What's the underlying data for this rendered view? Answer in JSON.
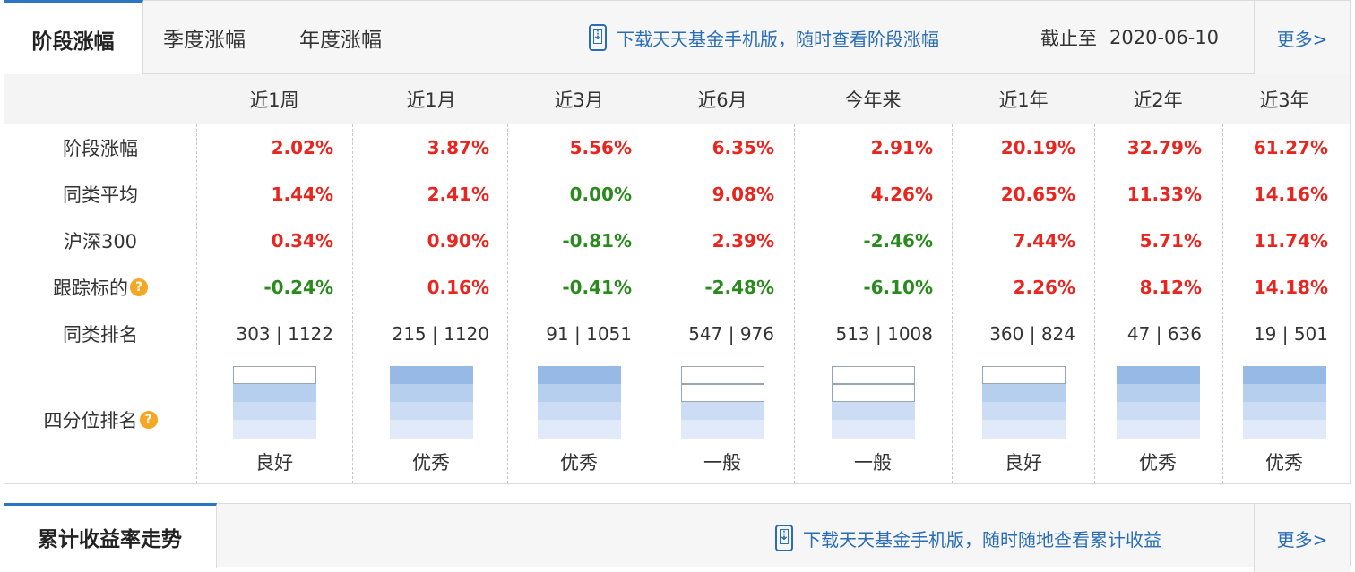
{
  "tabs": {
    "active": "阶段涨幅",
    "items": [
      "季度涨幅",
      "年度涨幅"
    ]
  },
  "promo1": "下载天天基金手机版，随时查看阶段涨幅",
  "date": {
    "label": "截止至",
    "value": "2020-06-10"
  },
  "more": "更多>",
  "columns": [
    "近1周",
    "近1月",
    "近3月",
    "近6月",
    "今年来",
    "近1年",
    "近2年",
    "近3年"
  ],
  "rows": [
    {
      "label": "阶段涨幅",
      "values": [
        "2.02%",
        "3.87%",
        "5.56%",
        "6.35%",
        "2.91%",
        "20.19%",
        "32.79%",
        "61.27%"
      ]
    },
    {
      "label": "同类平均",
      "values": [
        "1.44%",
        "2.41%",
        "0.00%",
        "9.08%",
        "4.26%",
        "20.65%",
        "11.33%",
        "14.16%"
      ]
    },
    {
      "label": "沪深300",
      "values": [
        "0.34%",
        "0.90%",
        "-0.81%",
        "2.39%",
        "-2.46%",
        "7.44%",
        "5.71%",
        "11.74%"
      ]
    },
    {
      "label": "跟踪标的",
      "values": [
        "-0.24%",
        "0.16%",
        "-0.41%",
        "-2.48%",
        "-6.10%",
        "2.26%",
        "8.12%",
        "14.18%"
      ]
    },
    {
      "label": "同类排名",
      "values": [
        "303 | 1122",
        "215 | 1120",
        "91 | 1051",
        "547 | 976",
        "513 | 1008",
        "360 | 824",
        "47 | 636",
        "19 | 501"
      ]
    }
  ],
  "quartile": {
    "label": "四分位排名",
    "ratings": [
      "良好",
      "优秀",
      "优秀",
      "一般",
      "一般",
      "良好",
      "优秀",
      "优秀"
    ],
    "levels": [
      3,
      4,
      4,
      2,
      2,
      3,
      4,
      4
    ]
  },
  "section2": {
    "title": "累计收益率走势",
    "promo": "下载天天基金手机版，随时随地查看累计收益",
    "more": "更多>"
  },
  "colors": {
    "up": "#e8251e",
    "down": "#2b8a1e",
    "accent": "#2a75c4",
    "link": "#2a6db5"
  }
}
